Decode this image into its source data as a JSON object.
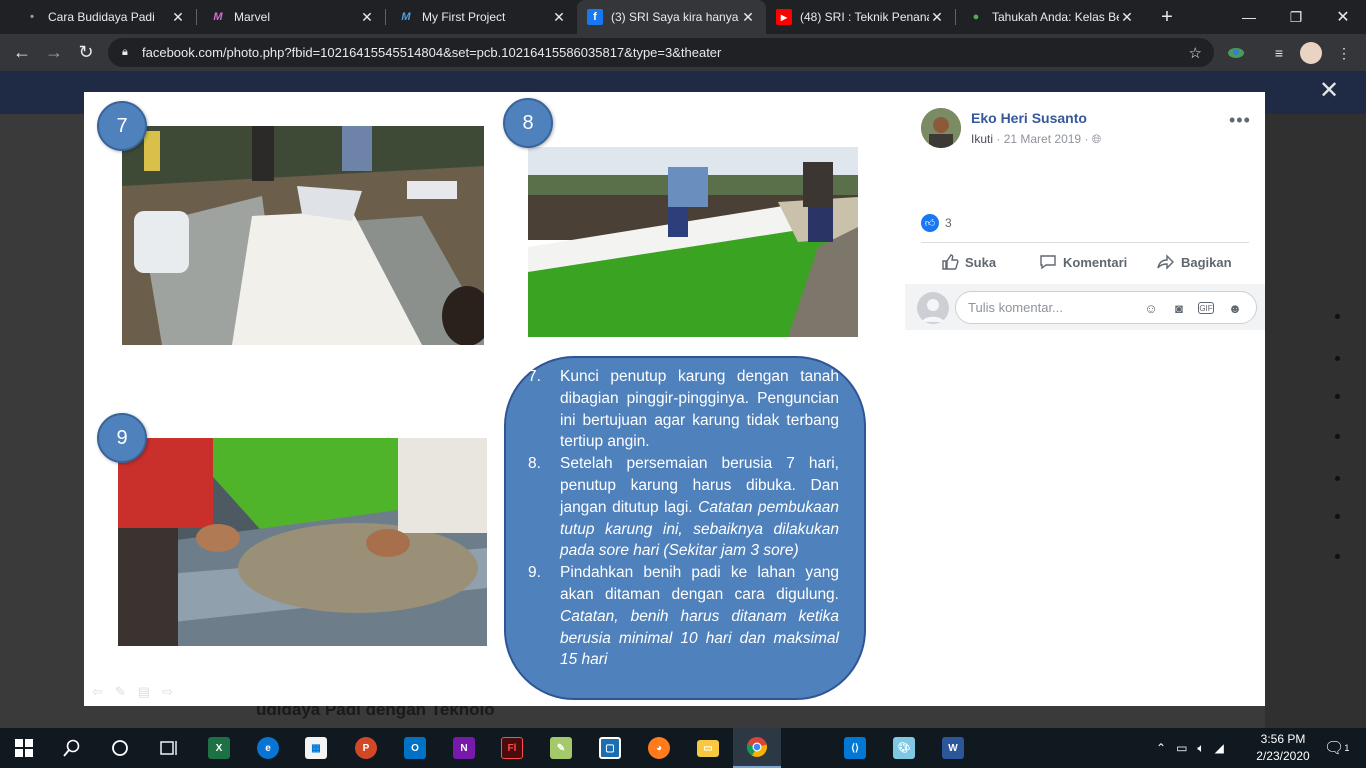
{
  "browser": {
    "tabs": [
      {
        "title": "Cara Budidaya Padi",
        "icon": "generic-dot-icon",
        "active": false
      },
      {
        "title": "Marvel",
        "icon": "marvel-icon",
        "active": false
      },
      {
        "title": "My First Project",
        "icon": "marvel-icon",
        "active": false
      },
      {
        "title": "(3) SRI Saya kira hanya t",
        "icon": "facebook-icon",
        "active": true
      },
      {
        "title": "(48) SRI : Teknik Penana",
        "icon": "youtube-icon",
        "active": false
      },
      {
        "title": "Tahukah Anda: Kelas Be",
        "icon": "web-icon",
        "active": false
      }
    ],
    "url": "facebook.com/photo.php?fbid=10216415545514804&set=pcb.10216415586035817&type=3&theater"
  },
  "photo": {
    "steps": [
      {
        "num": "7"
      },
      {
        "num": "8"
      },
      {
        "num": "9"
      }
    ],
    "instructions": [
      {
        "num": "7.",
        "text": "Kunci penutup karung dengan tanah dibagian pinggir-pingginya. Penguncian ini bertujuan agar karung tidak terbang tertiup angin.",
        "note": ""
      },
      {
        "num": "8.",
        "text": "Setelah persemaian berusia 7 hari, penutup karung harus dibuka. Dan jangan ditutup lagi.",
        "note": "Catatan pembukaan tutup karung ini, sebaiknya dilakukan pada sore hari (Sekitar jam 3 sore)"
      },
      {
        "num": "9.",
        "text": "Pindahkan benih padi ke lahan yang akan ditaman dengan cara digulung.",
        "note": "Catatan, benih harus ditanam ketika berusia minimal 10 hari dan maksimal 15 hari"
      }
    ]
  },
  "post": {
    "author": "Eko Heri Susanto",
    "follow": "Ikuti",
    "date": "21 Maret 2019",
    "like_count": "3",
    "actions": {
      "like": "Suka",
      "comment": "Komentari",
      "share": "Bagikan"
    },
    "comment_placeholder": "Tulis komentar..."
  },
  "background": {
    "caption_fragment": "udidaya Padi dengan Teknolo"
  },
  "taskbar": {
    "time": "3:56 PM",
    "date": "2/23/2020",
    "notifications": "1",
    "apps": [
      {
        "name": "start-button"
      },
      {
        "name": "search-button"
      },
      {
        "name": "cortana-button"
      },
      {
        "name": "task-view-button"
      },
      {
        "name": "excel"
      },
      {
        "name": "edge"
      },
      {
        "name": "store"
      },
      {
        "name": "powerpoint"
      },
      {
        "name": "outlook"
      },
      {
        "name": "onenote"
      },
      {
        "name": "flash"
      },
      {
        "name": "notepad"
      },
      {
        "name": "snip"
      },
      {
        "name": "firefox"
      },
      {
        "name": "file-explorer"
      },
      {
        "name": "chrome"
      },
      {
        "name": "vscode"
      },
      {
        "name": "paint"
      },
      {
        "name": "word"
      }
    ]
  },
  "colors": {
    "facebook_blue": "#365899",
    "slide_box": "#4f81bd",
    "chrome_dark": "#202124"
  }
}
